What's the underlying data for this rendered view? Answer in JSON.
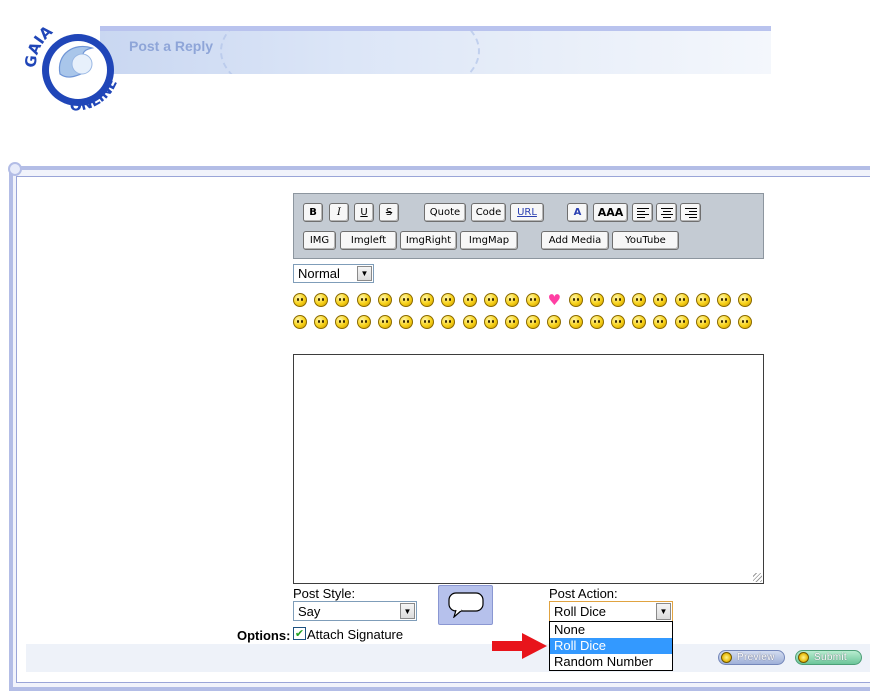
{
  "header": {
    "logo_text_top": "GAIA",
    "logo_text_bottom": "ONLINE",
    "page_title": "Post a Reply"
  },
  "toolbar": {
    "bold": "B",
    "italic": "I",
    "underline": "U",
    "strike": "S",
    "quote": "Quote",
    "code": "Code",
    "url": "URL",
    "font_color": "A",
    "font_size": "AAA",
    "img": "IMG",
    "imgleft": "Imgleft",
    "imgright": "ImgRight",
    "imgmap": "ImgMap",
    "add_media": "Add Media",
    "youtube": "YouTube"
  },
  "size_select": {
    "value": "Normal"
  },
  "emoticons": {
    "row1_count": 22,
    "row2_count": 22,
    "heart_index_row1": 12
  },
  "post_style": {
    "label": "Post Style:",
    "value": "Say"
  },
  "post_action": {
    "label": "Post Action:",
    "value": "Roll Dice",
    "options": [
      "None",
      "Roll Dice",
      "Random Number"
    ],
    "highlighted_index": 1
  },
  "options": {
    "label": "Options:",
    "attach_signature": "Attach Signature",
    "attach_checked": true
  },
  "buttons": {
    "preview": "Preview",
    "submit": "Submit"
  },
  "colors": {
    "accent": "#b3bde6",
    "highlight": "#3399ff",
    "annotation_arrow": "#e8141b"
  }
}
